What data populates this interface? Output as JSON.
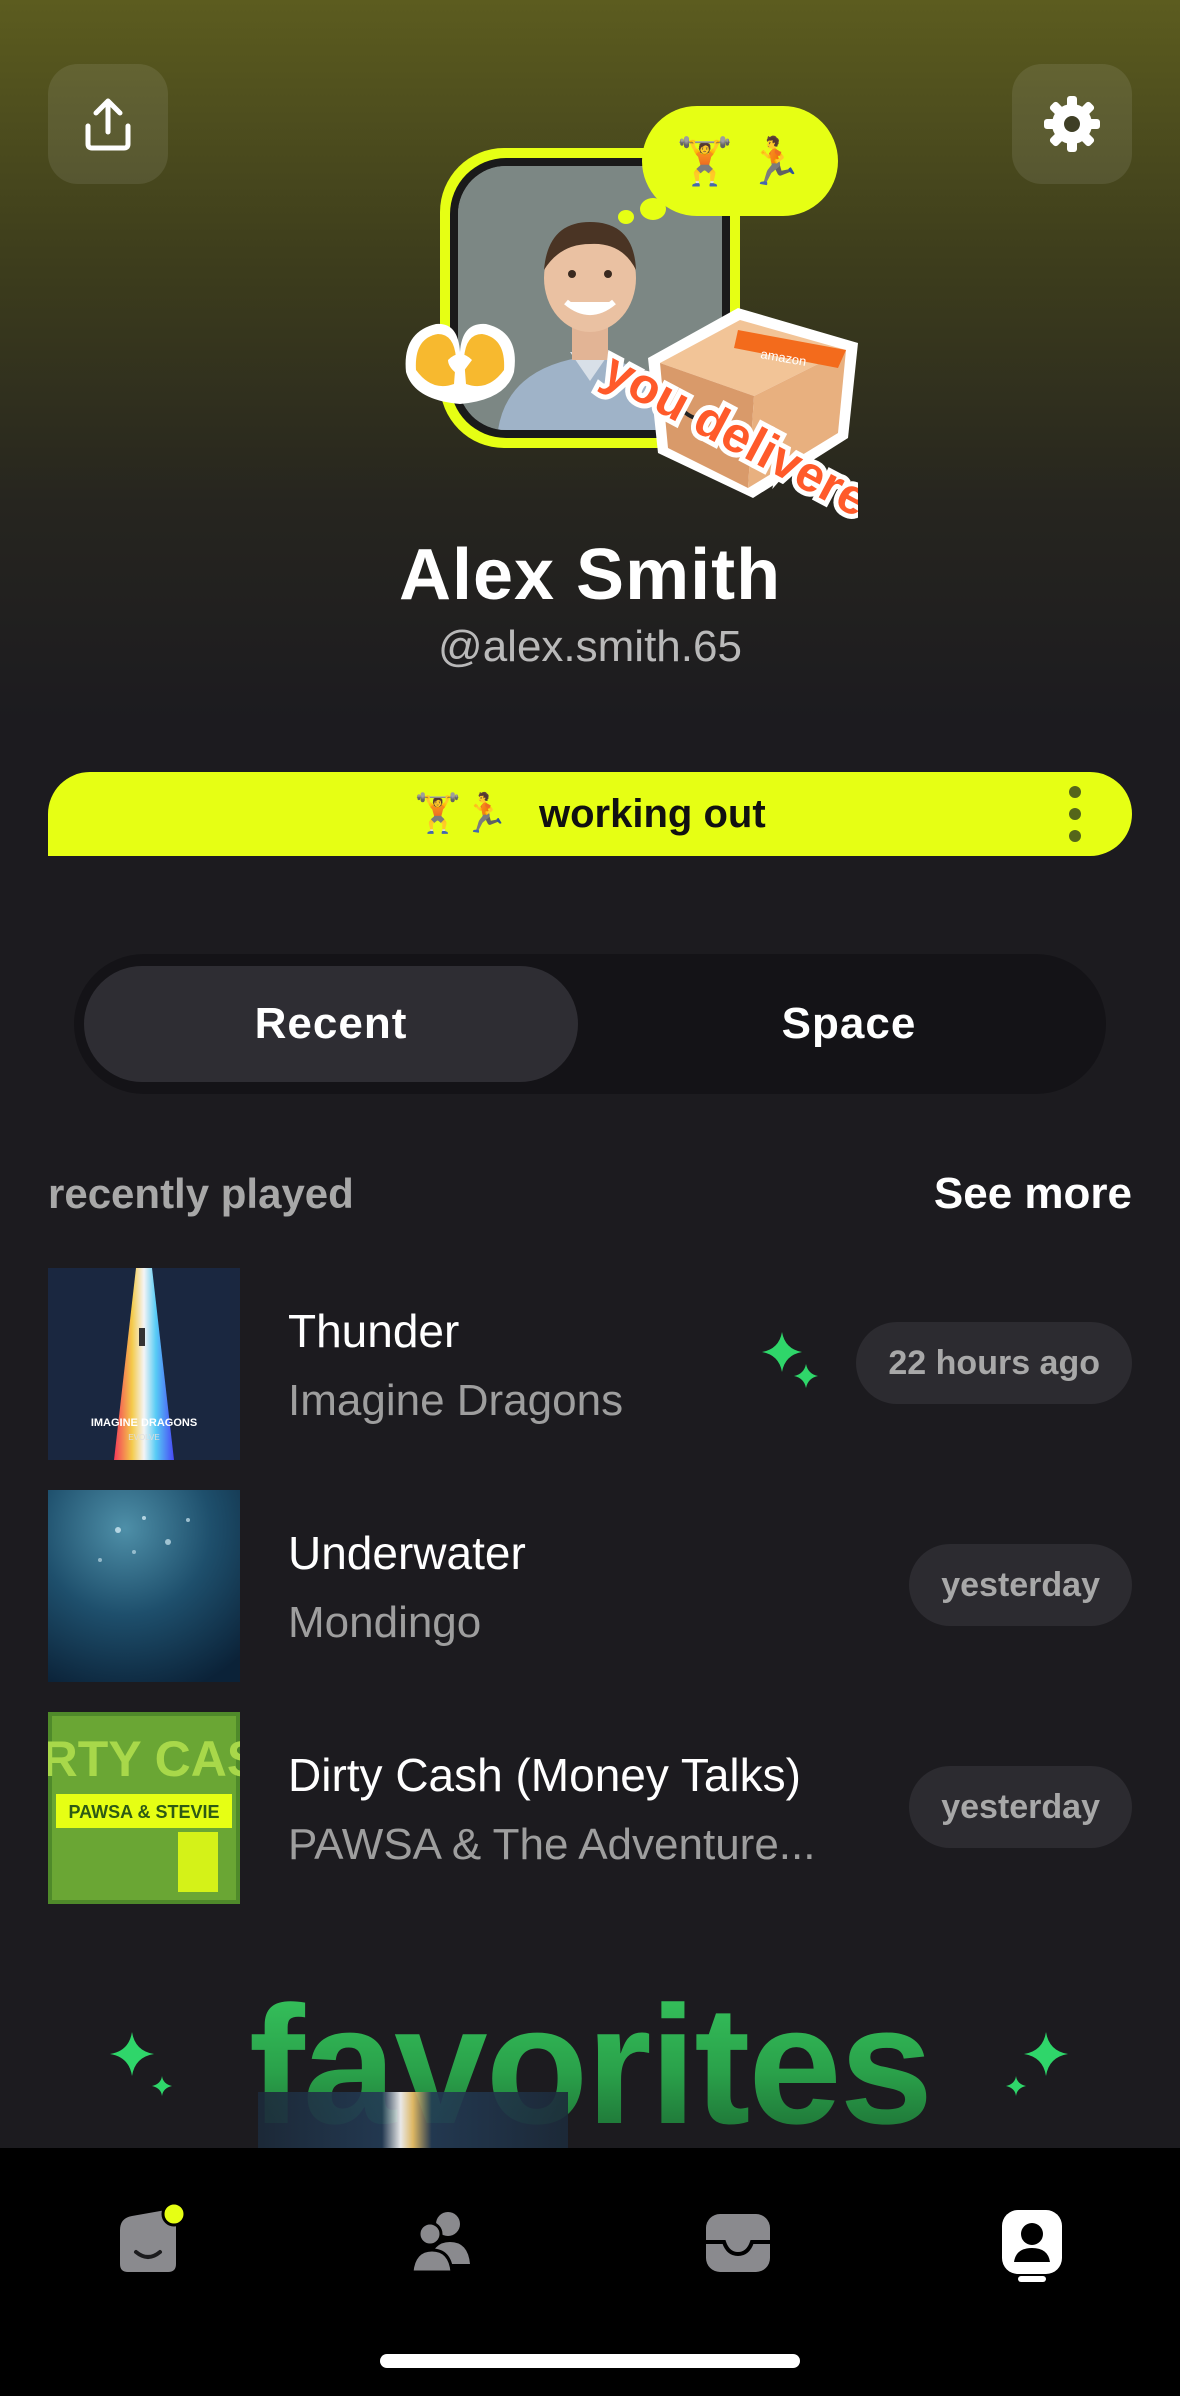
{
  "profile": {
    "name": "Alex Smith",
    "handle": "@alex.smith.65",
    "bubble_emojis": "🏋️ 🏃"
  },
  "status": {
    "emojis": "🏋️🏃",
    "text": "working out"
  },
  "segmented": {
    "recent_label": "Recent",
    "space_label": "Space",
    "selected": "Recent"
  },
  "recently_played": {
    "title": "recently played",
    "see_more_label": "See more",
    "tracks": [
      {
        "title": "Thunder",
        "artist": "Imagine Dragons",
        "time": "22 hours ago",
        "cover_text": "IMAGINE DRAGONS",
        "cover_sub": "EVOLVE"
      },
      {
        "title": "Underwater",
        "artist": "Mondingo",
        "time": "yesterday"
      },
      {
        "title": "Dirty Cash (Money Talks)",
        "artist": "PAWSA & The Adventure...",
        "time": "yesterday",
        "cover_text": "DIRTY CASH",
        "cover_sub": "PAWSA & STEVIE"
      }
    ]
  },
  "favorites": {
    "title": "favorites"
  },
  "stickers": {
    "package_text": "you delivered",
    "package_brand": "amazon"
  },
  "colors": {
    "accent": "#e6ff14",
    "background": "#1c1b1f",
    "favorites_green": "#2aa14a",
    "sparkle_green": "#2fd66a"
  },
  "tabbar": {
    "items": [
      "home-icon",
      "friends-icon",
      "inbox-icon",
      "profile-icon"
    ],
    "selected": "profile-icon"
  }
}
